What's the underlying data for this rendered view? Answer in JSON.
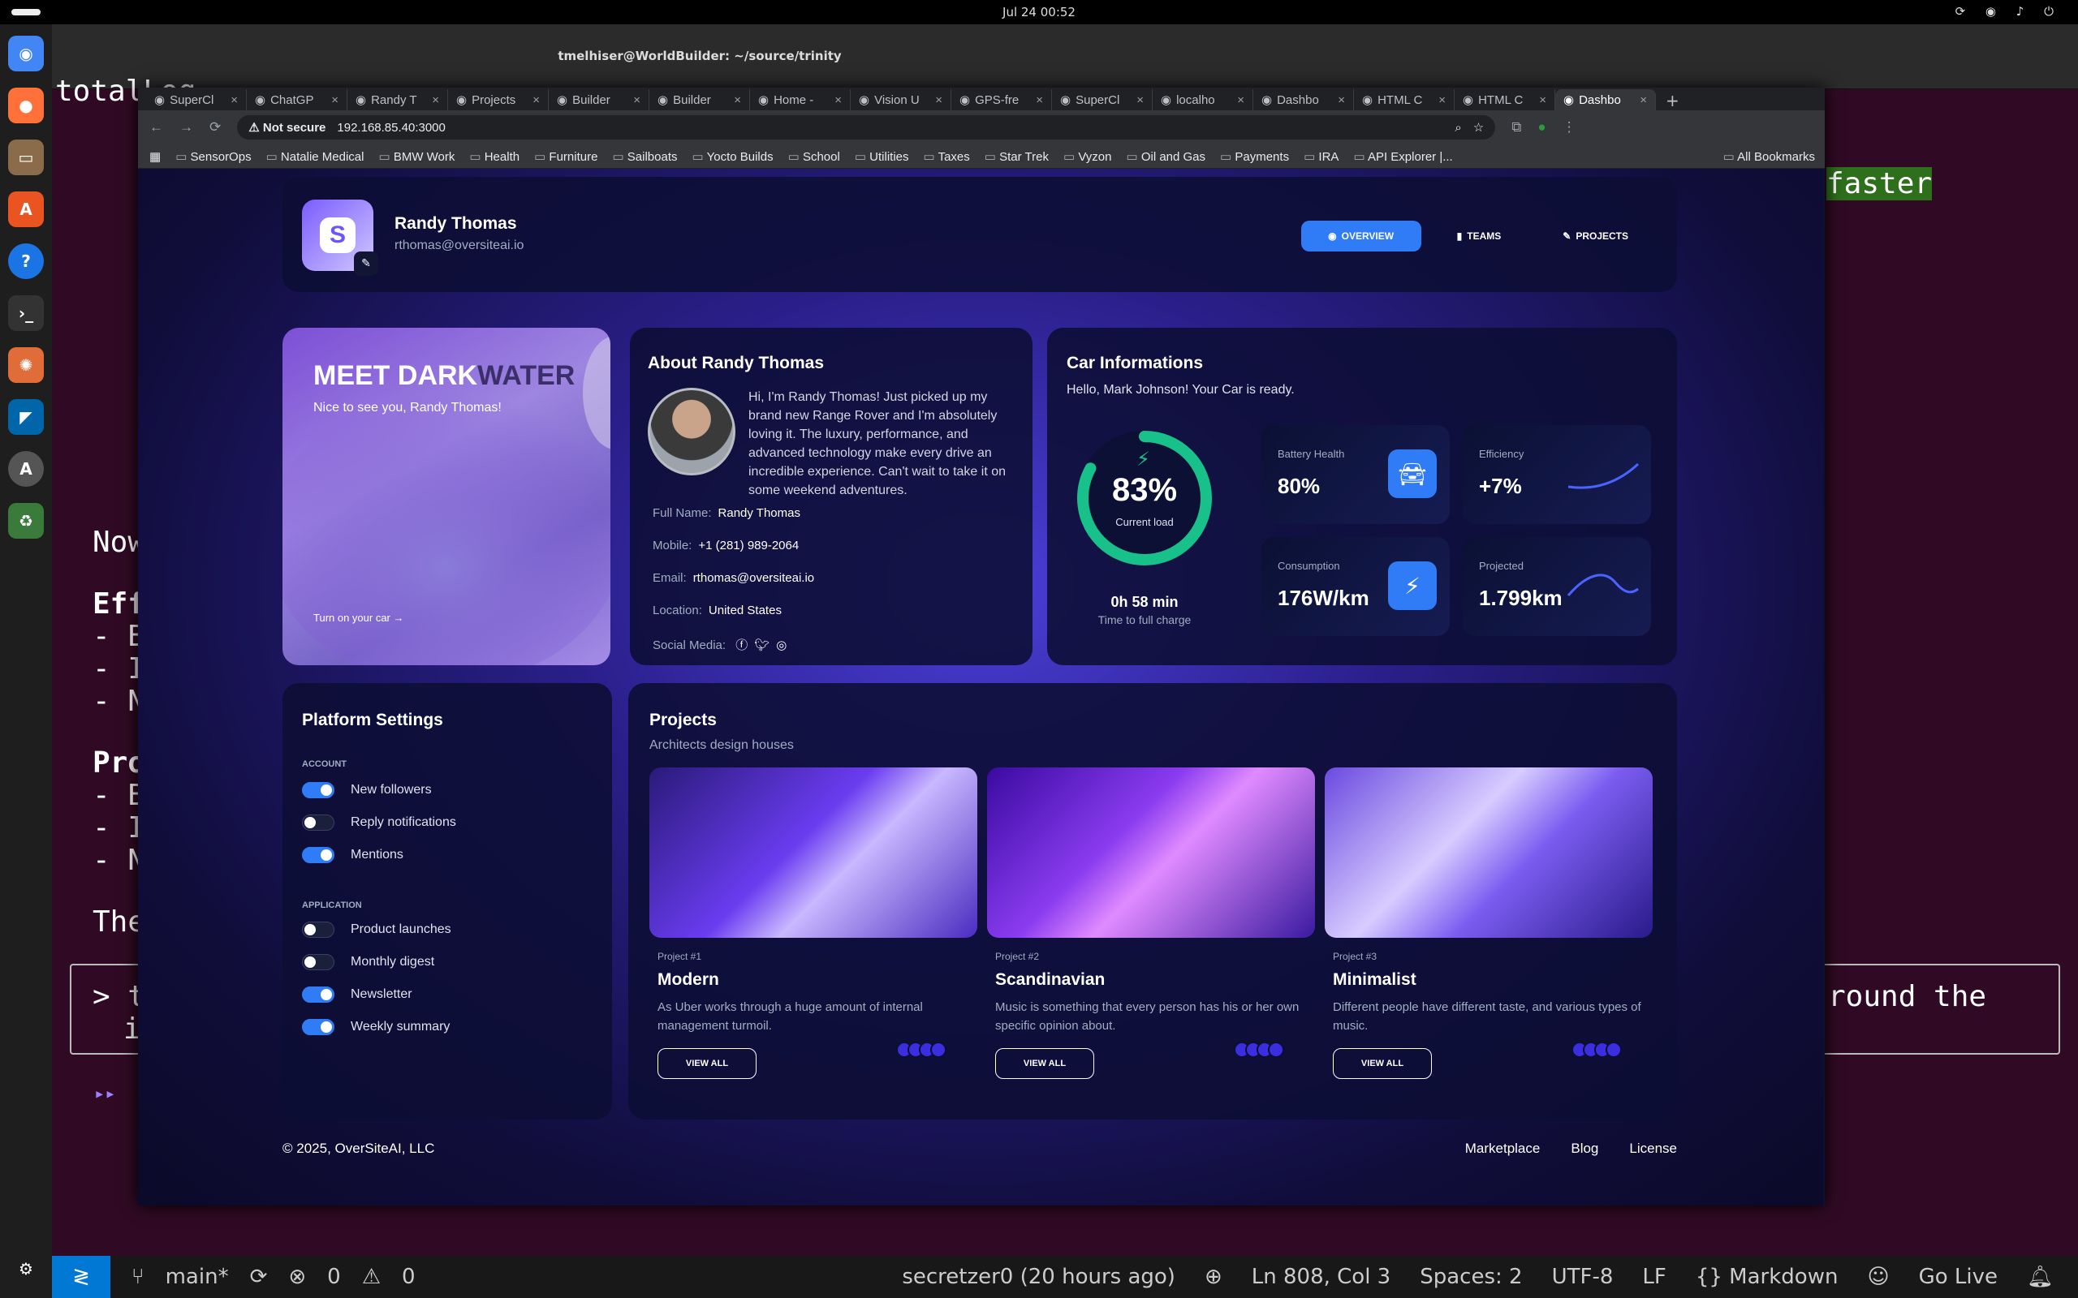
{
  "system": {
    "clock": "Jul 24  00:52"
  },
  "terminal": {
    "title": "tmelhiser@WorldBuilder: ~/source/trinity",
    "lines": [
      "totalLog",
      "Now",
      "Eff",
      "- B",
      "- I",
      "- N",
      "Pro",
      "- B",
      "- I",
      "- N",
      "The"
    ],
    "faster": "faster",
    "prompt_left": "> t",
    "prompt_left2": "i",
    "prompt_right": "round the",
    "arrows": "▸▸"
  },
  "vscode_status": {
    "branch": "main*",
    "problems": "0",
    "warnings": "0",
    "blame": "secretzer0 (20 hours ago)",
    "position": "Ln 808, Col 3",
    "spaces": "Spaces: 2",
    "encoding": "UTF-8",
    "eol": "LF",
    "language": "{} Markdown",
    "golive": "Go Live"
  },
  "browser": {
    "tabs": [
      "SuperCl",
      "ChatGP",
      "Randy T",
      "Projects",
      "Builder",
      "Builder",
      "Home -",
      "Vision U",
      "GPS-fre",
      "SuperCl",
      "localho",
      "Dashbo",
      "HTML C",
      "HTML C",
      "Dashbo"
    ],
    "not_secure": "Not secure",
    "url": "192.168.85.40:3000",
    "bookmarks": [
      "SensorOps",
      "Natalie Medical",
      "BMW Work",
      "Health",
      "Furniture",
      "Sailboats",
      "Yocto Builds",
      "School",
      "Utilities",
      "Taxes",
      "Star Trek",
      "Vyzon",
      "Oil and Gas",
      "Payments",
      "IRA",
      "API Explorer |..."
    ],
    "all_bookmarks": "All Bookmarks"
  },
  "header": {
    "name": "Randy Thomas",
    "email": "rthomas@oversiteai.io",
    "nav": [
      "OVERVIEW",
      "TEAMS",
      "PROJECTS"
    ]
  },
  "welcome": {
    "title_a": "MEET DARK",
    "title_b": "WATER",
    "subtitle": "Nice to see you, Randy Thomas!",
    "cta": "Turn on your car →"
  },
  "about": {
    "title": "About Randy Thomas",
    "bio": "Hi, I'm Randy Thomas! Just picked up my brand new Range Rover and I'm absolutely loving it. The luxury, performance, and advanced technology make every drive an incredible experience. Can't wait to take it on some weekend adventures.",
    "full_name_label": "Full Name:",
    "full_name": "Randy Thomas",
    "mobile_label": "Mobile:",
    "mobile": "+1 (281) 989-2064",
    "email_label": "Email:",
    "email": "rthomas@oversiteai.io",
    "location_label": "Location:",
    "location": "United States",
    "social_label": "Social Media:"
  },
  "car": {
    "title": "Car Informations",
    "hello": "Hello, Mark Johnson! Your Car is ready.",
    "load_value": "83%",
    "load_label": "Current load",
    "load_fraction": 0.83,
    "charge_time": "0h 58 min",
    "charge_label": "Time to full charge",
    "stats": [
      {
        "label": "Battery Health",
        "value": "80%",
        "icon": "car-icon"
      },
      {
        "label": "Efficiency",
        "value": "+7%",
        "icon": "sparkline"
      },
      {
        "label": "Consumption",
        "value": "176W/km",
        "icon": "bolt-icon"
      },
      {
        "label": "Projected",
        "value": "1.799km",
        "icon": "sparkline"
      }
    ],
    "accent": "#19c18a"
  },
  "settings": {
    "title": "Platform Settings",
    "account_label": "ACCOUNT",
    "application_label": "APPLICATION",
    "account": [
      {
        "label": "New followers",
        "on": true
      },
      {
        "label": "Reply notifications",
        "on": false
      },
      {
        "label": "Mentions",
        "on": true
      }
    ],
    "application": [
      {
        "label": "Product launches",
        "on": false
      },
      {
        "label": "Monthly digest",
        "on": false
      },
      {
        "label": "Newsletter",
        "on": true
      },
      {
        "label": "Weekly summary",
        "on": true
      }
    ]
  },
  "projects": {
    "title": "Projects",
    "subtitle": "Architects design houses",
    "items": [
      {
        "num": "Project #1",
        "title": "Modern",
        "desc": "As Uber works through a huge amount of internal management turmoil.",
        "button": "VIEW ALL"
      },
      {
        "num": "Project #2",
        "title": "Scandinavian",
        "desc": "Music is something that every person has his or her own specific opinion about.",
        "button": "VIEW ALL"
      },
      {
        "num": "Project #3",
        "title": "Minimalist",
        "desc": "Different people have different taste, and various types of music.",
        "button": "VIEW ALL"
      }
    ]
  },
  "footer": {
    "copyright": "© 2025, OverSiteAI, LLC",
    "links": [
      "Marketplace",
      "Blog",
      "License"
    ]
  },
  "colors": {
    "primary": "#2f7cf6",
    "bg": "#0d1030"
  }
}
